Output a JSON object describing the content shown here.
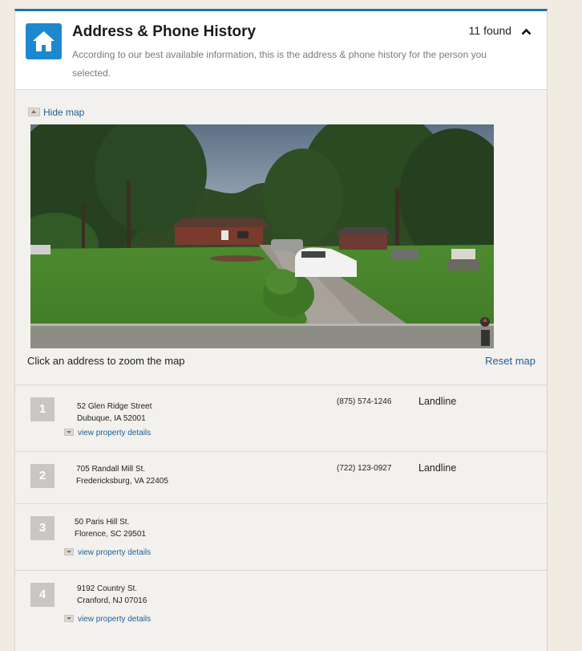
{
  "header": {
    "title": "Address & Phone History",
    "description": "According to our best available information, this is the address & phone history for the person you selected.",
    "found_count": "11 found",
    "home_icon": "home-icon",
    "collapse_icon": "chevron-up-icon"
  },
  "map": {
    "hide_label": "Hide map",
    "zoom_hint": "Click an address to zoom the map",
    "reset_label": "Reset map"
  },
  "addresses": [
    {
      "number": "1",
      "line1": "52 Glen Ridge Street",
      "line2": "Dubuque, IA 52001",
      "phone": "(875) 574-1246",
      "phone_type": "Landline",
      "details_label": "view property details"
    },
    {
      "number": "2",
      "line1": "705 Randall Mill St.",
      "line2": "Fredericksburg, VA 22405",
      "phone": "(722) 123-0927",
      "phone_type": "Landline"
    },
    {
      "number": "3",
      "line1": "50 Paris Hill St.",
      "line2": "Florence, SC 29501",
      "details_label": "view property details"
    },
    {
      "number": "4",
      "line1": "9192 Country St.",
      "line2": "Cranford, NJ 07016",
      "details_label": "view property details"
    }
  ],
  "colors": {
    "accent": "#1e88cf",
    "link": "#1f5e98",
    "badge": "#c9c7c3"
  }
}
